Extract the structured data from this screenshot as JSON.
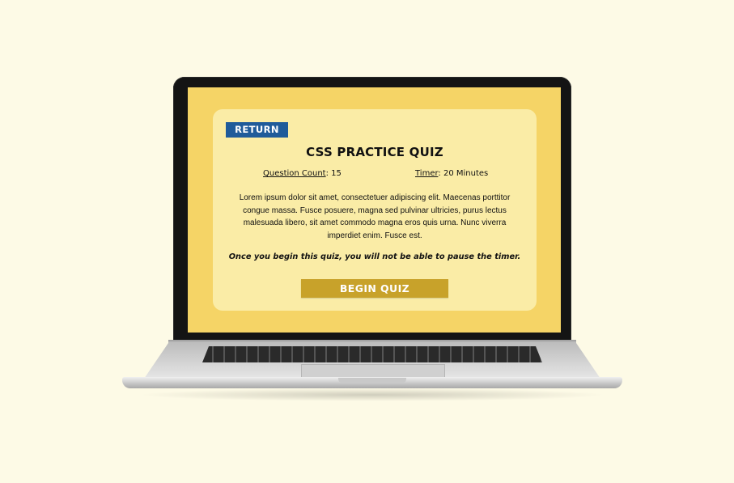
{
  "quiz": {
    "return_label": "RETURN",
    "title": "CSS PRACTICE QUIZ",
    "question_count_label": "Question Count",
    "question_count_value": ": 15",
    "timer_label": "Timer",
    "timer_value": ": 20 Minutes",
    "description": "Lorem ipsum dolor sit amet, consectetuer adipiscing elit. Maecenas porttitor congue massa. Fusce posuere, magna sed pulvinar ultricies, purus lectus malesuada libero, sit amet commodo magna eros quis urna. Nunc viverra imperdiet enim. Fusce est.",
    "warning": "Once you begin this quiz, you will not be able to pause the timer.",
    "begin_label": "BEGIN QUIZ"
  },
  "colors": {
    "page_background": "#fdfae6",
    "screen_background": "#f5d466",
    "card_background": "#faeca6",
    "return_button": "#1f5b9a",
    "begin_button": "#c8a22a"
  },
  "icons": [
    "laptop-frame"
  ]
}
